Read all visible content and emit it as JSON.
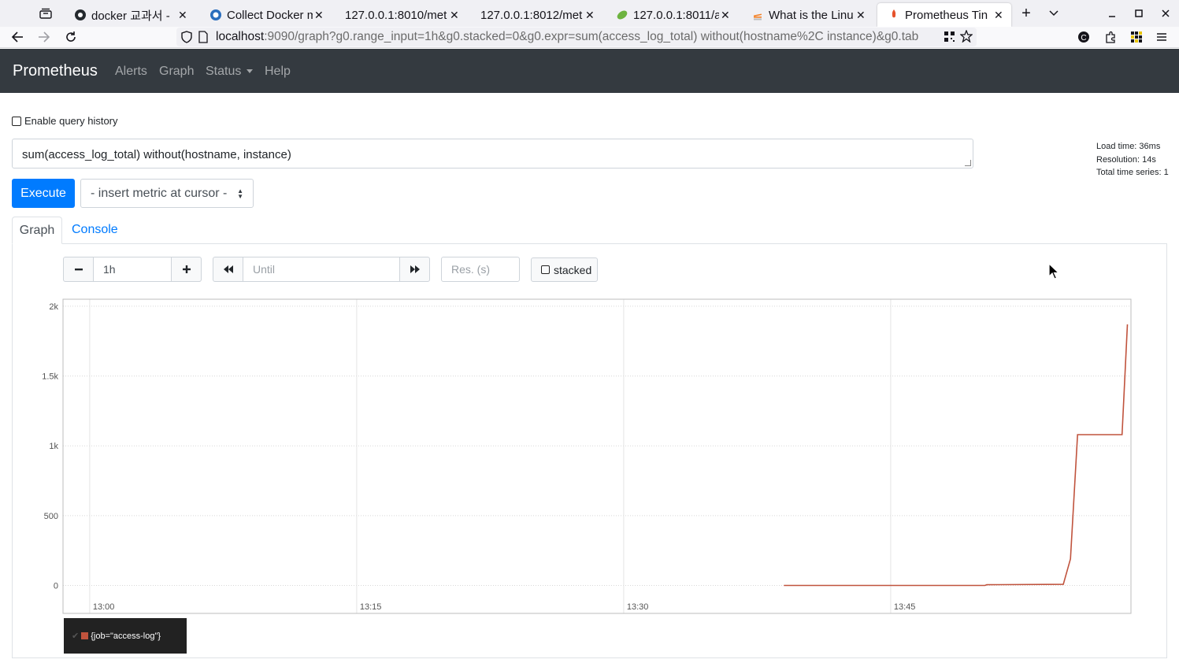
{
  "browser": {
    "tabs": [
      {
        "title": "docker 교과서 - ",
        "icon": "github-icon",
        "left": 0
      },
      {
        "title": "Collect Docker m",
        "icon": "browser-icon"
      },
      {
        "title": "127.0.0.1:8010/met",
        "icon": "none"
      },
      {
        "title": "127.0.0.1:8012/met",
        "icon": "none"
      },
      {
        "title": "127.0.0.1:8011/a",
        "icon": "leaf-icon"
      },
      {
        "title": "What is the Linu",
        "icon": "stackoverflow-icon"
      },
      {
        "title": "Prometheus Tin",
        "icon": "prometheus-icon"
      }
    ],
    "url_host": "localhost",
    "url_rest": ":9090/graph?g0.range_input=1h&g0.stacked=0&g0.expr=sum(access_log_total) without(hostname%2C instance)&g0.tab"
  },
  "header": {
    "brand": "Prometheus",
    "nav": [
      "Alerts",
      "Graph",
      "Status",
      "Help"
    ]
  },
  "query": {
    "history_label": "Enable query history",
    "expression": "sum(access_log_total) without(hostname, instance)",
    "execute_label": "Execute",
    "metric_select": "- insert metric at cursor -"
  },
  "stats": {
    "load_time": "Load time: 36ms",
    "resolution": "Resolution: 14s",
    "total_series": "Total time series: 1"
  },
  "tabs": {
    "graph": "Graph",
    "console": "Console"
  },
  "controls": {
    "range_value": "1h",
    "until_placeholder": "Until",
    "res_placeholder": "Res. (s)",
    "stacked_label": "stacked"
  },
  "chart_data": {
    "type": "line",
    "title": "",
    "xlabel": "",
    "ylabel": "",
    "x_ticks": [
      "13:00",
      "13:15",
      "13:30",
      "13:45"
    ],
    "y_ticks": [
      "0",
      "500",
      "1k",
      "1.5k",
      "2k"
    ],
    "ylim": [
      -200,
      2050
    ],
    "xlim_minutes": [
      -1.5,
      58.5
    ],
    "grid": true,
    "legend_position": "bottom-left",
    "series": [
      {
        "name": "{job=\"access-log\"}",
        "color": "#c0533d",
        "points": [
          [
            39,
            0
          ],
          [
            50.3,
            0
          ],
          [
            50.4,
            5
          ],
          [
            54.7,
            8
          ],
          [
            55.1,
            190
          ],
          [
            55.5,
            1080
          ],
          [
            58.0,
            1080
          ],
          [
            58.3,
            1870
          ]
        ]
      }
    ]
  }
}
